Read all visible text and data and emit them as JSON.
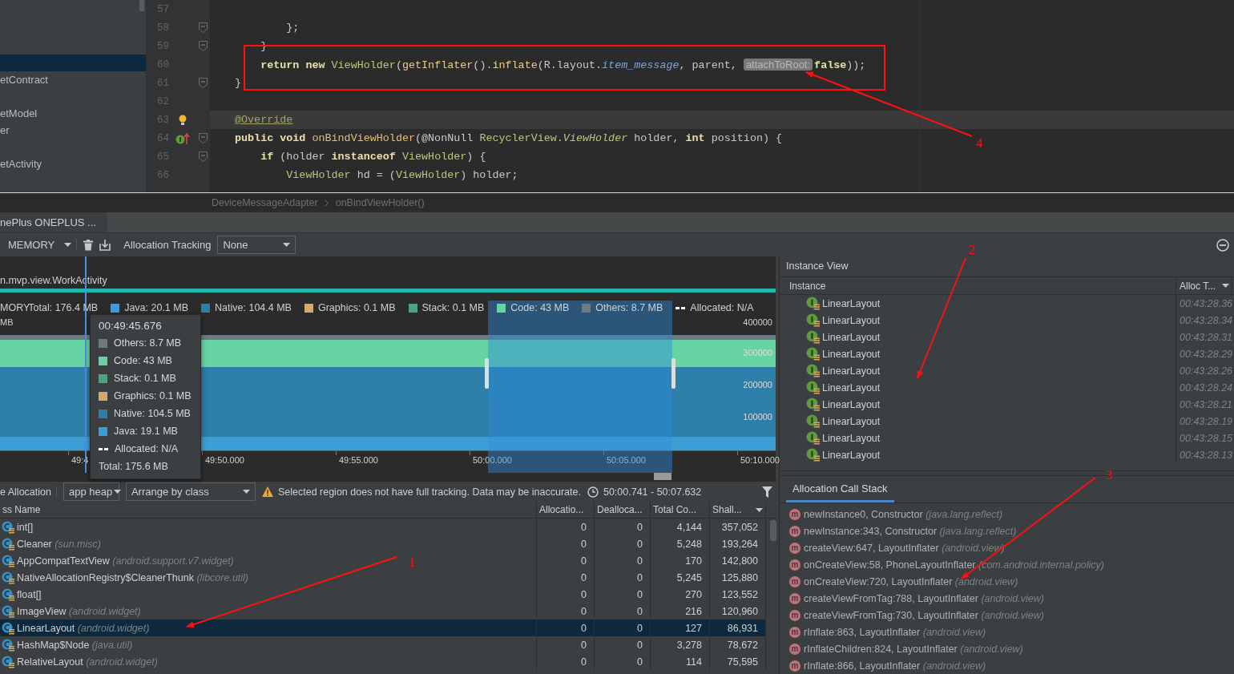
{
  "project_tree": {
    "items": [
      {
        "selected": true
      },
      {
        "label": "etContract",
        "selected": false
      },
      {
        "selected": false
      },
      {
        "label": "etModel",
        "selected": false
      },
      {
        "label": "er",
        "selected": false
      },
      {
        "selected": false
      },
      {
        "label": "etActivity",
        "selected": false
      }
    ]
  },
  "editor": {
    "lines": [
      {
        "number": "57",
        "fold": false,
        "current": false
      },
      {
        "number": "58",
        "fold": true,
        "current": false,
        "tokens": [
          {
            "kind": "plain",
            "text": "        };"
          }
        ]
      },
      {
        "number": "59",
        "fold": true,
        "current": false,
        "tokens": [
          {
            "kind": "plain",
            "text": "    }"
          }
        ]
      },
      {
        "number": "60",
        "fold": false,
        "current": false,
        "tokens": [
          {
            "kind": "keyword",
            "text": "    return new "
          },
          {
            "kind": "type",
            "text": "ViewHolder"
          },
          {
            "kind": "plain",
            "text": "("
          },
          {
            "kind": "method",
            "text": "getInflater"
          },
          {
            "kind": "plain",
            "text": "()."
          },
          {
            "kind": "method",
            "text": "inflate"
          },
          {
            "kind": "plain",
            "text": "(R.layout."
          },
          {
            "kind": "field",
            "text": "item_message"
          },
          {
            "kind": "plain",
            "text": ", parent, "
          },
          {
            "kind": "hint",
            "text": "attachToRoot:"
          },
          {
            "kind": "keyword",
            "text": "false"
          },
          {
            "kind": "plain",
            "text": "));"
          }
        ]
      },
      {
        "number": "61",
        "fold": true,
        "current": false,
        "tokens": [
          {
            "kind": "plain",
            "text": "}"
          }
        ]
      },
      {
        "number": "62",
        "fold": false,
        "current": false
      },
      {
        "number": "63",
        "fold": false,
        "current": true,
        "gutter_icon": {
          "kind": "bulb"
        },
        "tokens": [
          {
            "kind": "annotation",
            "text": "@Override"
          }
        ]
      },
      {
        "number": "64",
        "fold": true,
        "current": false,
        "gutter_icon": {
          "kind": "override"
        },
        "tokens": [
          {
            "kind": "keyword",
            "text": "public void "
          },
          {
            "kind": "decl",
            "text": "onBindViewHolder"
          },
          {
            "kind": "plain",
            "text": "(@NonNull "
          },
          {
            "kind": "type",
            "text": "RecyclerView."
          },
          {
            "kind": "typeitalic",
            "text": "ViewHolder"
          },
          {
            "kind": "plain",
            "text": " holder, "
          },
          {
            "kind": "keyword",
            "text": "int"
          },
          {
            "kind": "plain",
            "text": " position) {"
          }
        ]
      },
      {
        "number": "65",
        "fold": true,
        "current": false,
        "tokens": [
          {
            "kind": "keyword",
            "text": "    if"
          },
          {
            "kind": "plain",
            "text": " (holder "
          },
          {
            "kind": "keyword",
            "text": "instanceof "
          },
          {
            "kind": "type",
            "text": "ViewHolder"
          },
          {
            "kind": "plain",
            "text": ") {"
          }
        ]
      },
      {
        "number": "66",
        "fold": false,
        "current": false,
        "tokens": [
          {
            "kind": "type",
            "text": "        ViewHolder"
          },
          {
            "kind": "plain",
            "text": " hd = ("
          },
          {
            "kind": "type",
            "text": "ViewHolder"
          },
          {
            "kind": "plain",
            "text": ") holder;"
          }
        ]
      }
    ]
  },
  "breadcrumbs": [
    "DeviceMessageAdapter",
    "onBindViewHolder()"
  ],
  "device_tab": {
    "label": "nePlus ONEPLUS ..."
  },
  "toolbar": {
    "profiler": "MEMORY",
    "tracking_label": "Allocation Tracking",
    "tracking_value": "None"
  },
  "memory_chart": {
    "activity": "n.mvp.view.WorkActivity",
    "legend_prefix": "MORY",
    "total": "Total: 176.4 MB",
    "unit": "MB",
    "legend": [
      {
        "kind": "swatch",
        "label": "Java: 20.1 MB",
        "color": "#3c9ed6"
      },
      {
        "kind": "swatch",
        "label": "Native: 104.4 MB",
        "color": "#2d7ea8"
      },
      {
        "kind": "swatch",
        "label": "Graphics: 0.1 MB",
        "color": "#d5a86c"
      },
      {
        "kind": "swatch",
        "label": "Stack: 0.1 MB",
        "color": "#4aa381"
      },
      {
        "kind": "swatch",
        "label": "Code: 43 MB",
        "color": "#66d3a3"
      },
      {
        "kind": "swatch",
        "label": "Others: 8.7 MB",
        "color": "#6b7a83"
      },
      {
        "kind": "dash",
        "label": "Allocated: N/A",
        "color": "#ffffff"
      }
    ],
    "y_labels": [
      "400000",
      "300000",
      "200000",
      "100000"
    ],
    "time_labels": [
      "49:4",
      "49:50.000",
      "49:55.000",
      "50:00.000",
      "50:05.000",
      "50:10.000"
    ],
    "tooltip": {
      "time": "00:49:45.676",
      "total": "Total: 175.6 MB",
      "items": [
        {
          "kind": "swatch",
          "label": "Others: 8.7 MB",
          "color": "#6b7a83"
        },
        {
          "kind": "swatch",
          "label": "Code: 43 MB",
          "color": "#66d3a3"
        },
        {
          "kind": "swatch",
          "label": "Stack: 0.1 MB",
          "color": "#4aa381"
        },
        {
          "kind": "swatch",
          "label": "Graphics: 0.1 MB",
          "color": "#d5a86c"
        },
        {
          "kind": "swatch",
          "label": "Native: 104.5 MB",
          "color": "#2d7ea8"
        },
        {
          "kind": "swatch",
          "label": "Java: 19.1 MB",
          "color": "#3c9ed6"
        },
        {
          "kind": "dash",
          "label": "Allocated: N/A",
          "color": "#ffffff"
        }
      ]
    }
  },
  "filter_bar": {
    "view": "e Allocation",
    "heap": "app heap",
    "arrange": "Arrange by class",
    "warning": "Selected region does not have full tracking. Data may be inaccurate.",
    "range": "50:00.741 - 50:07.632"
  },
  "class_table": {
    "columns": [
      {
        "label": "ss Name",
        "sorted": false
      },
      {
        "label": "Allocatio...",
        "sorted": false
      },
      {
        "label": "Dealloca...",
        "sorted": false
      },
      {
        "label": "Total Co...",
        "sorted": false
      },
      {
        "label": "Shall...",
        "sorted": true
      }
    ],
    "rows": [
      {
        "name": "int[]",
        "allocations": "0",
        "deallocations": "0",
        "total": "4,144",
        "shallow": "357,052",
        "selected": false
      },
      {
        "name": "Cleaner",
        "package": "(sun.misc)",
        "allocations": "0",
        "deallocations": "0",
        "total": "5,248",
        "shallow": "193,264",
        "selected": false
      },
      {
        "name": "AppCompatTextView",
        "package": "(android.support.v7.widget)",
        "allocations": "0",
        "deallocations": "0",
        "total": "170",
        "shallow": "142,800",
        "selected": false
      },
      {
        "name": "NativeAllocationRegistry$CleanerThunk",
        "package": "(libcore.util)",
        "allocations": "0",
        "deallocations": "0",
        "total": "5,245",
        "shallow": "125,880",
        "selected": false
      },
      {
        "name": "float[]",
        "allocations": "0",
        "deallocations": "0",
        "total": "270",
        "shallow": "123,552",
        "selected": false
      },
      {
        "name": "ImageView",
        "package": "(android.widget)",
        "allocations": "0",
        "deallocations": "0",
        "total": "216",
        "shallow": "120,960",
        "selected": false
      },
      {
        "name": "LinearLayout",
        "package": "(android.widget)",
        "allocations": "0",
        "deallocations": "0",
        "total": "127",
        "shallow": "86,931",
        "selected": true
      },
      {
        "name": "HashMap$Node",
        "package": "(java.util)",
        "allocations": "0",
        "deallocations": "0",
        "total": "3,278",
        "shallow": "78,672",
        "selected": false
      },
      {
        "name": "RelativeLayout",
        "package": "(android.widget)",
        "allocations": "0",
        "deallocations": "0",
        "total": "114",
        "shallow": "75,595",
        "selected": false
      }
    ]
  },
  "instance_view": {
    "title": "Instance View",
    "columns": [
      {
        "label": "Instance",
        "sorted": false
      },
      {
        "label": "Alloc T...",
        "sorted": true
      }
    ],
    "rows": [
      {
        "name": "LinearLayout",
        "time": "00:43:28.36"
      },
      {
        "name": "LinearLayout",
        "time": "00:43:28.34"
      },
      {
        "name": "LinearLayout",
        "time": "00:43:28.31"
      },
      {
        "name": "LinearLayout",
        "time": "00:43:28.29"
      },
      {
        "name": "LinearLayout",
        "time": "00:43:28.26"
      },
      {
        "name": "LinearLayout",
        "time": "00:43:28.24"
      },
      {
        "name": "LinearLayout",
        "time": "00:43:28.21"
      },
      {
        "name": "LinearLayout",
        "time": "00:43:28.19"
      },
      {
        "name": "LinearLayout",
        "time": "00:43:28.15"
      },
      {
        "name": "LinearLayout",
        "time": "00:43:28.13"
      }
    ]
  },
  "call_stack": {
    "tab": {
      "label": "Allocation Call Stack",
      "selected": true
    },
    "frames": [
      {
        "badge": "m",
        "method": "newInstance0, Constructor",
        "package": "(java.lang.reflect)"
      },
      {
        "badge": "m",
        "method": "newInstance:343, Constructor",
        "package": "(java.lang.reflect)"
      },
      {
        "badge": "m",
        "method": "createView:647, LayoutInflater",
        "package": "(android.view)"
      },
      {
        "badge": "m",
        "method": "onCreateView:58, PhoneLayoutInflater",
        "package": "(com.android.internal.policy)"
      },
      {
        "badge": "m",
        "method": "onCreateView:720, LayoutInflater",
        "package": "(android.view)"
      },
      {
        "badge": "m",
        "method": "createViewFromTag:788, LayoutInflater",
        "package": "(android.view)"
      },
      {
        "badge": "m",
        "method": "createViewFromTag:730, LayoutInflater",
        "package": "(android.view)"
      },
      {
        "badge": "m",
        "method": "rInflate:863, LayoutInflater",
        "package": "(android.view)"
      },
      {
        "badge": "m",
        "method": "rInflateChildren:824, LayoutInflater",
        "package": "(android.view)"
      },
      {
        "badge": "m",
        "method": "rInflate:866, LayoutInflater",
        "package": "(android.view)"
      }
    ]
  },
  "annotations": [
    {
      "label": "1"
    },
    {
      "label": "2"
    },
    {
      "label": "3"
    },
    {
      "label": "4"
    }
  ]
}
